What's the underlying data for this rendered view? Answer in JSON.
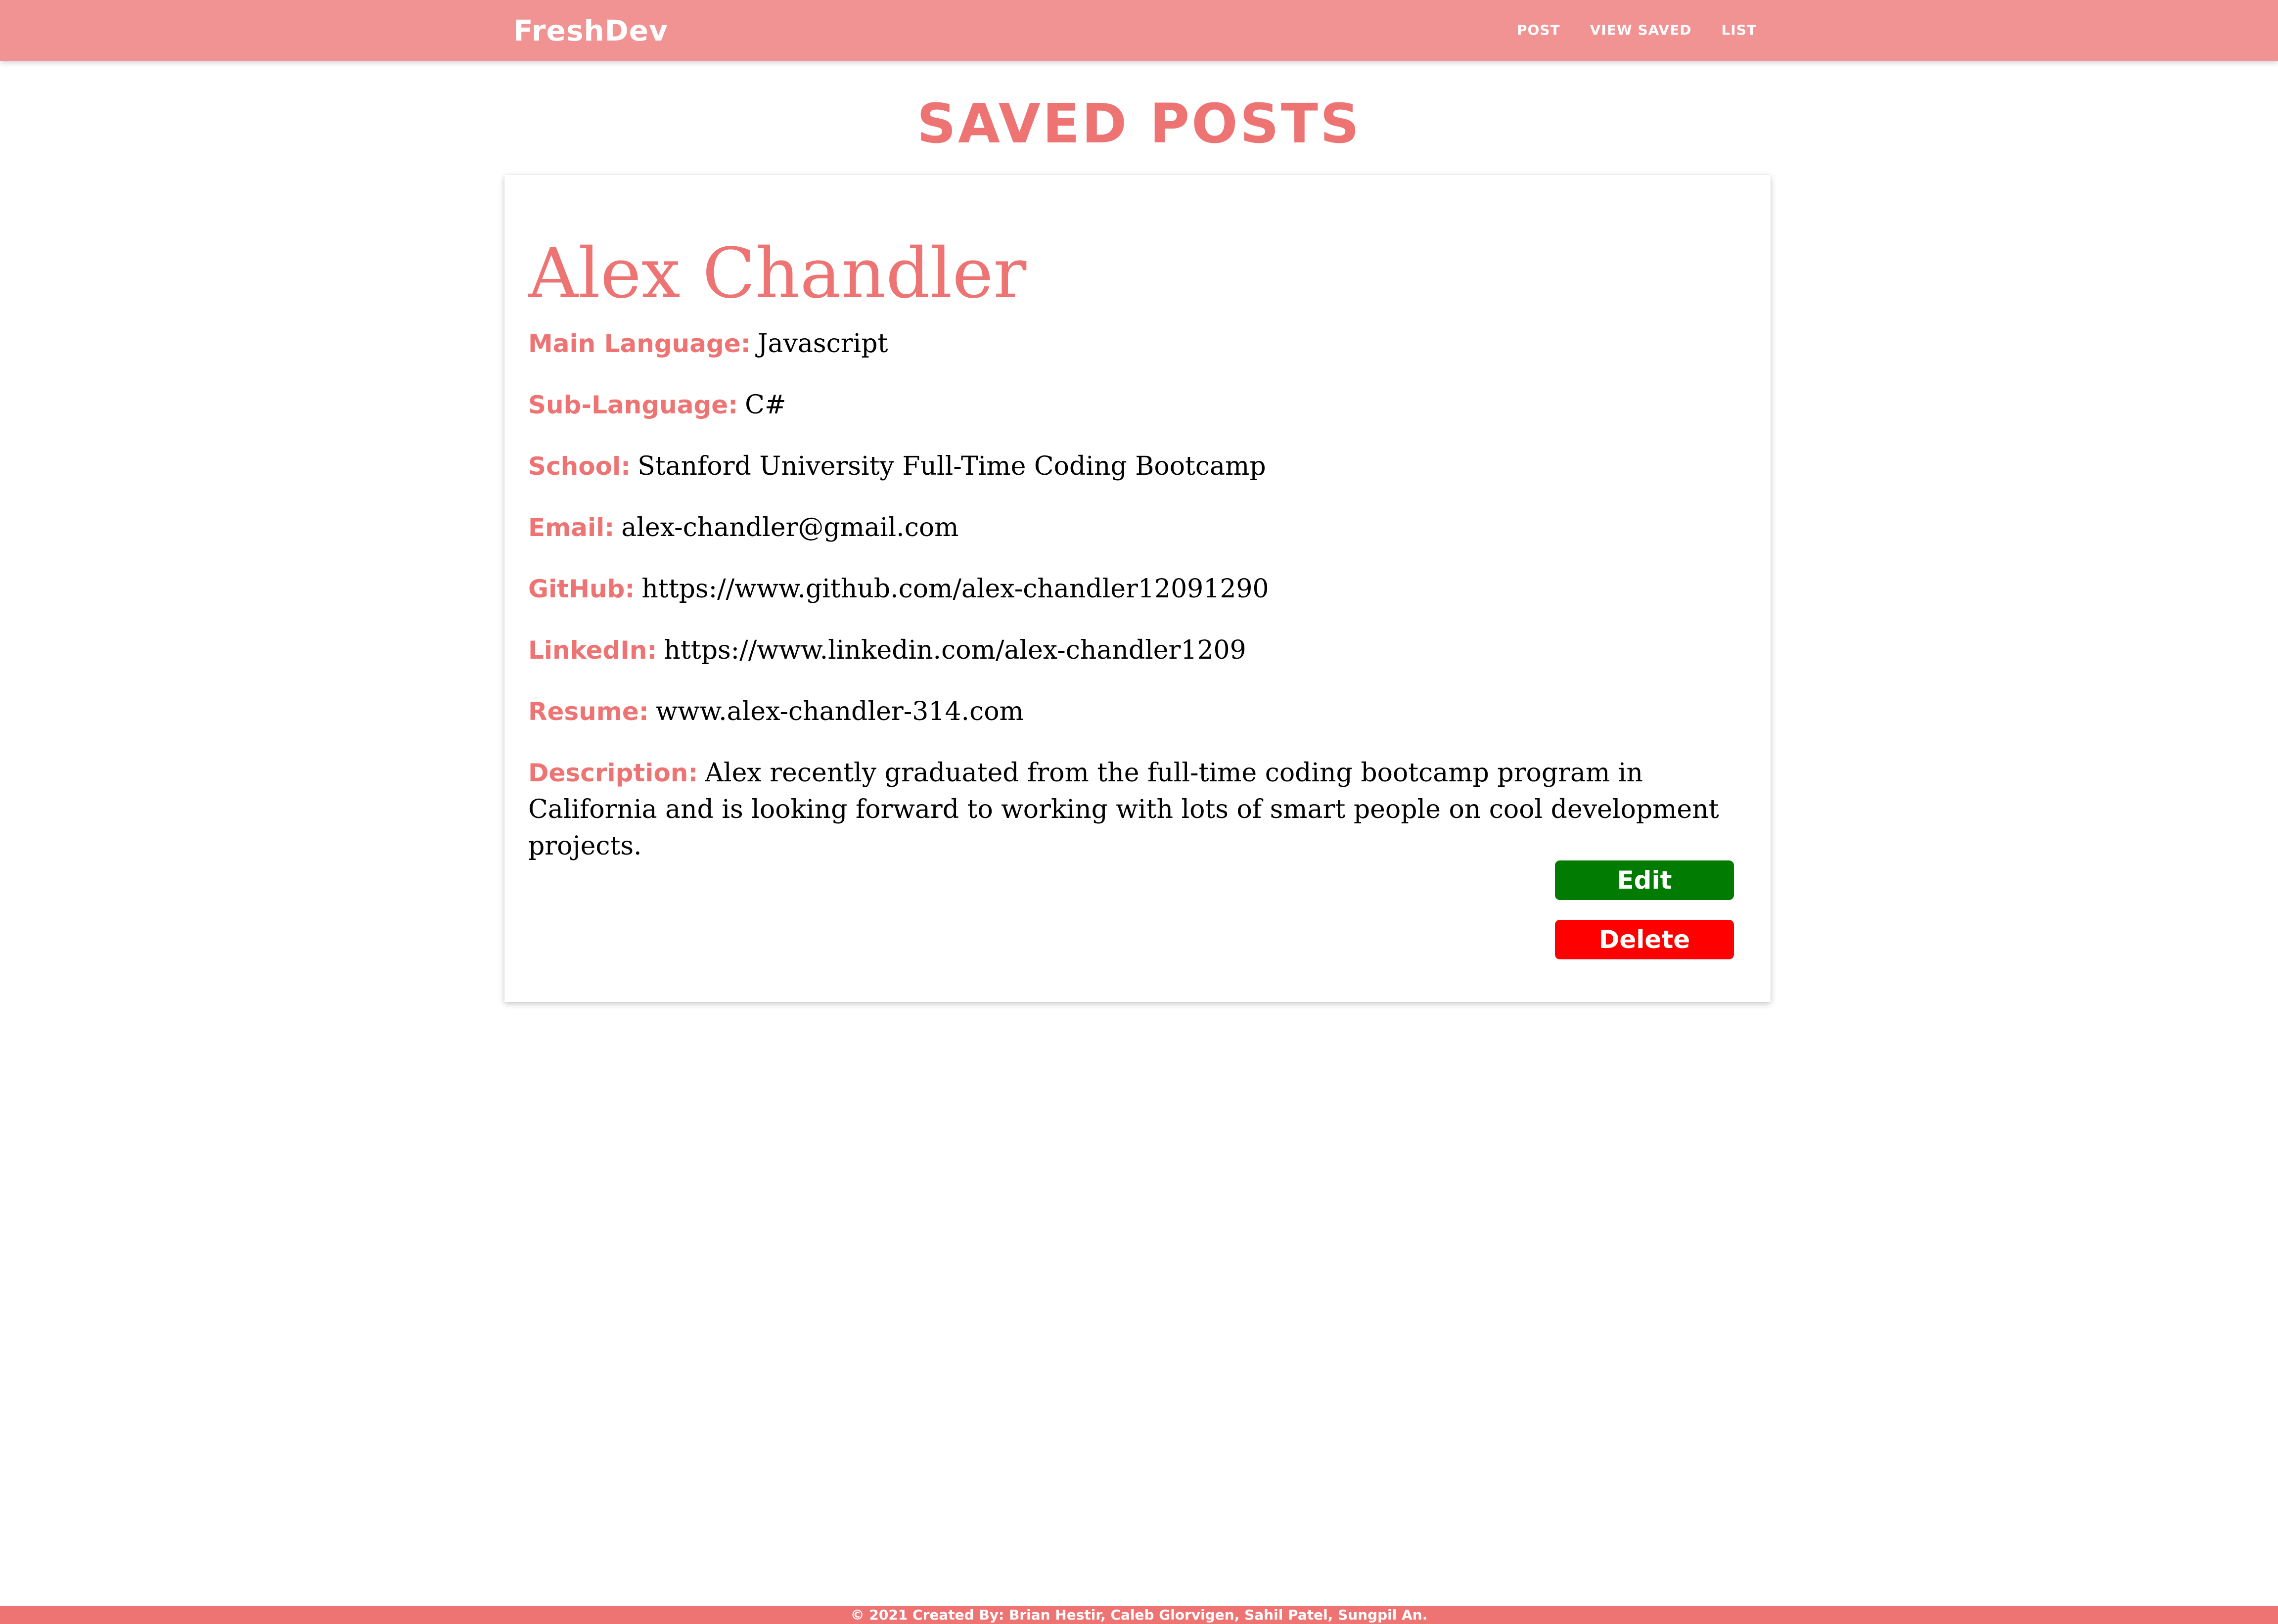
{
  "navbar": {
    "brand": "FreshDev",
    "links": [
      {
        "label": "POST"
      },
      {
        "label": "VIEW SAVED"
      },
      {
        "label": "LIST"
      }
    ]
  },
  "page": {
    "title": "SAVED POSTS"
  },
  "post": {
    "name": "Alex Chandler",
    "fields": [
      {
        "label": "Main Language:",
        "value": "Javascript"
      },
      {
        "label": "Sub-Language:",
        "value": "C#"
      },
      {
        "label": "School:",
        "value": "Stanford University Full-Time Coding Bootcamp"
      },
      {
        "label": "Email:",
        "value": "alex-chandler@gmail.com"
      },
      {
        "label": "GitHub:",
        "value": "https://www.github.com/alex-chandler12091290"
      },
      {
        "label": "LinkedIn:",
        "value": "https://www.linkedin.com/alex-chandler1209"
      },
      {
        "label": "Resume:",
        "value": "www.alex-chandler-314.com"
      },
      {
        "label": "Description:",
        "value": "Alex recently graduated from the full-time coding bootcamp program in California and is looking forward to working with lots of smart people on cool development projects."
      }
    ],
    "edit_label": "Edit",
    "delete_label": "Delete"
  },
  "footer": {
    "text": "© 2021 Created By: Brian Hestir, Caleb Glorvigen, Sahil Patel, Sungpil An."
  },
  "colors": {
    "navbar_bg": "#f29393",
    "accent": "#ee7474",
    "edit_button": "#027b02",
    "delete_button": "#ff0000"
  }
}
